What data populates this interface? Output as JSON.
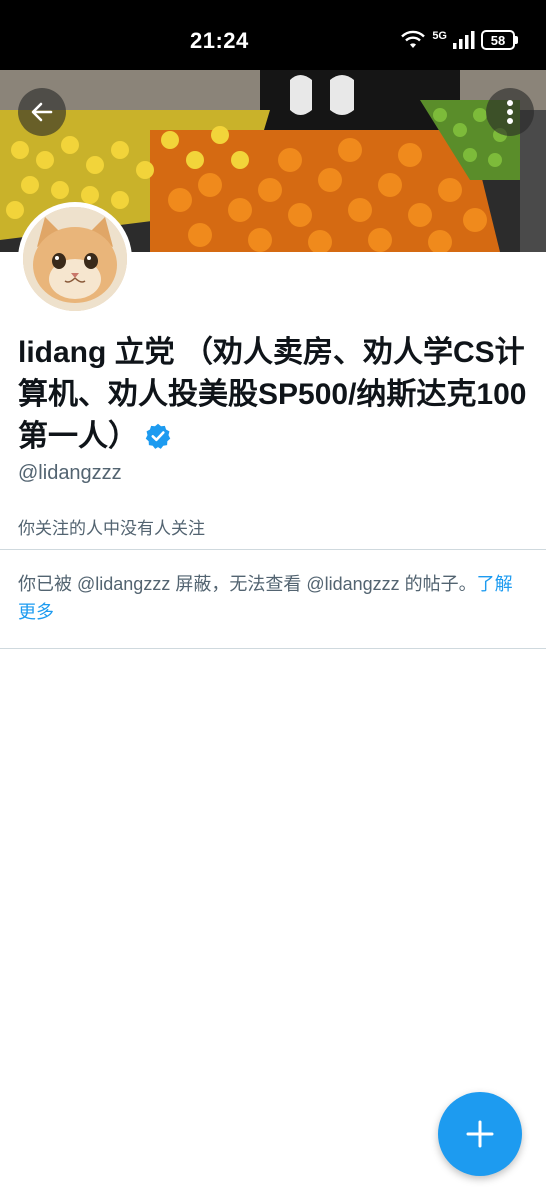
{
  "status_bar": {
    "time": "21:24",
    "network": "5G",
    "battery": "58"
  },
  "header": {
    "back_icon": "arrow-left-icon",
    "more_icon": "more-vertical-icon"
  },
  "profile": {
    "display_name": "lidang 立党 （劝人卖房、劝人学CS计算机、劝人投美股SP500/纳斯达克100第一人）",
    "handle": "@lidangzzz",
    "verified": true,
    "followers_note": "你关注的人中没有人关注"
  },
  "blocked": {
    "message": "你已被 @lidangzzz 屏蔽，无法查看 @lidangzzz 的帖子。",
    "learn_more": "了解更多"
  },
  "fab": {
    "icon": "plus-icon"
  },
  "colors": {
    "accent": "#1d9bf0",
    "text_primary": "#0f1419",
    "text_secondary": "#536471",
    "divider": "#cfd9de"
  }
}
